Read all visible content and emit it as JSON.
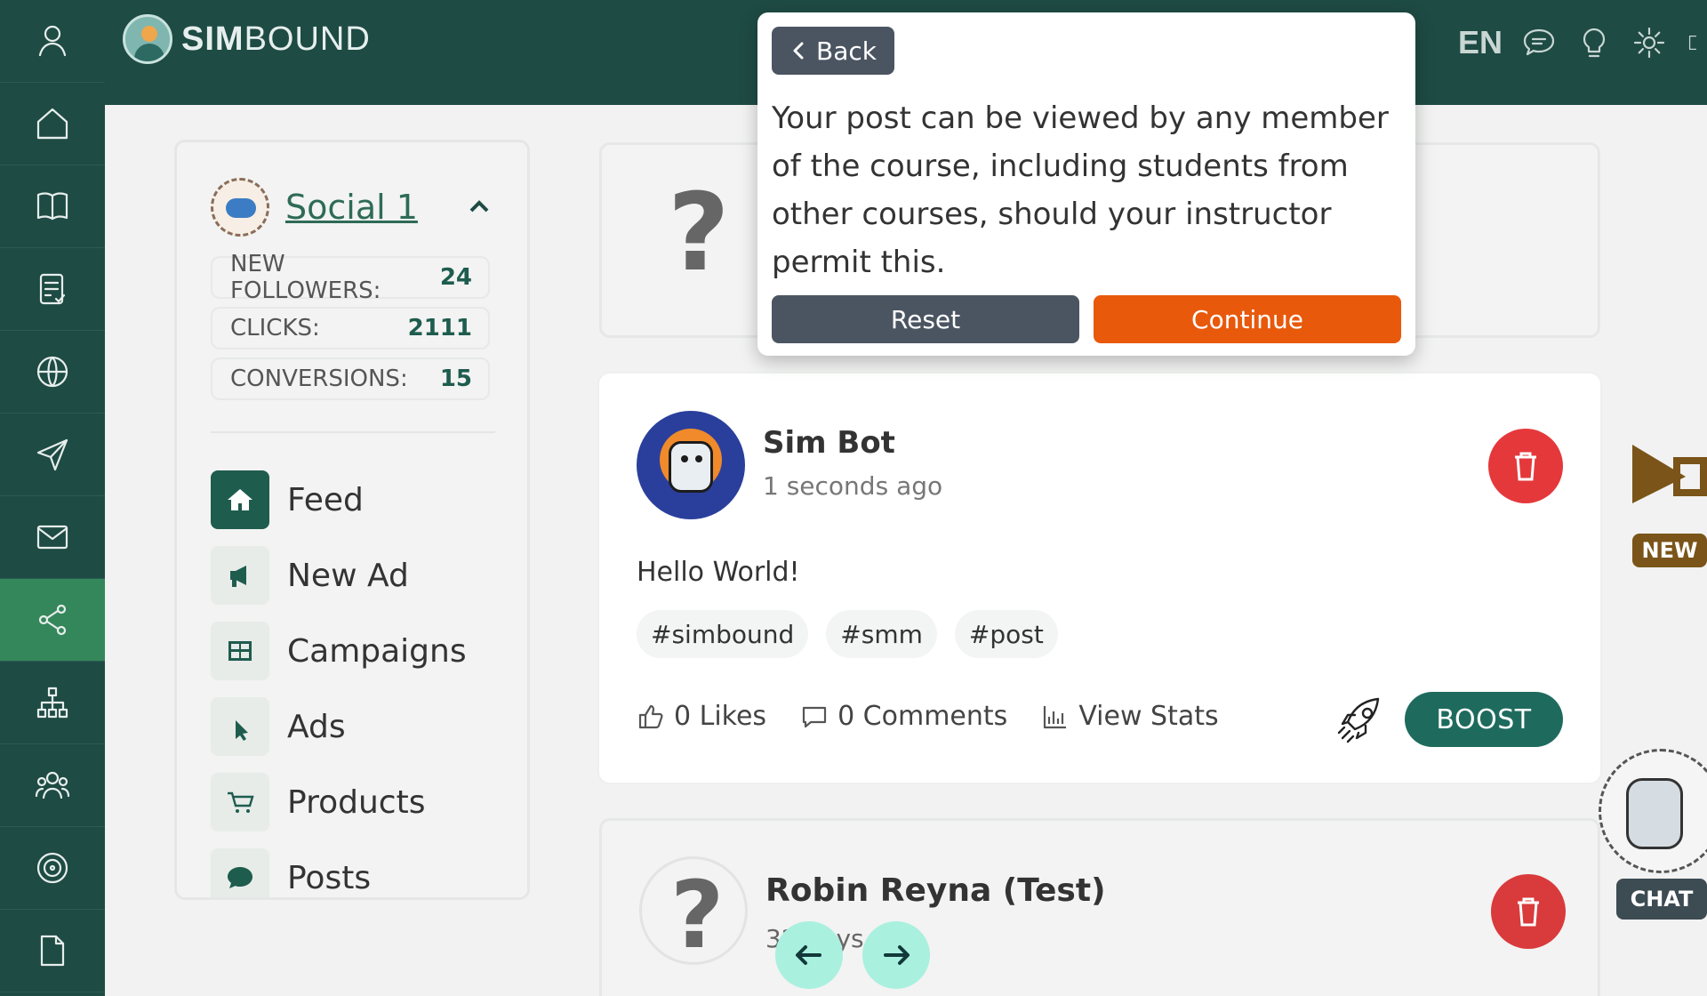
{
  "brand": {
    "bold": "SIM",
    "light": "BOUND"
  },
  "topbar": {
    "language": "EN"
  },
  "social": {
    "title": "Social 1",
    "stats": [
      {
        "label": "NEW FOLLOWERS:",
        "value": "24"
      },
      {
        "label": "CLICKS:",
        "value": "2111"
      },
      {
        "label": "CONVERSIONS:",
        "value": "15"
      }
    ],
    "menu": [
      {
        "label": "Feed"
      },
      {
        "label": "New Ad"
      },
      {
        "label": "Campaigns"
      },
      {
        "label": "Ads"
      },
      {
        "label": "Products"
      },
      {
        "label": "Posts"
      }
    ]
  },
  "post": {
    "author": "Sim Bot",
    "time": "1 seconds ago",
    "body": "Hello World!",
    "tags": [
      "#simbound",
      "#smm",
      "#post"
    ],
    "likes": "0 Likes",
    "comments": "0 Comments",
    "view_stats": "View Stats",
    "boost": "BOOST"
  },
  "post2": {
    "author": "Robin Reyna (Test)",
    "time_partial": "32 days"
  },
  "placeholder": {
    "mark": "?"
  },
  "widgets": {
    "new_badge": "NEW",
    "chat_badge": "CHAT"
  },
  "tour": {
    "back": "Back",
    "text": "Your post can be viewed by any member of the course, including students from other courses, should your instructor permit this.",
    "reset": "Reset",
    "continue": "Continue"
  },
  "colors": {
    "rail": "#1e4b44",
    "active": "#34875a",
    "accent": "#1e6b5e",
    "danger": "#e5383b",
    "continue": "#e8590c"
  }
}
